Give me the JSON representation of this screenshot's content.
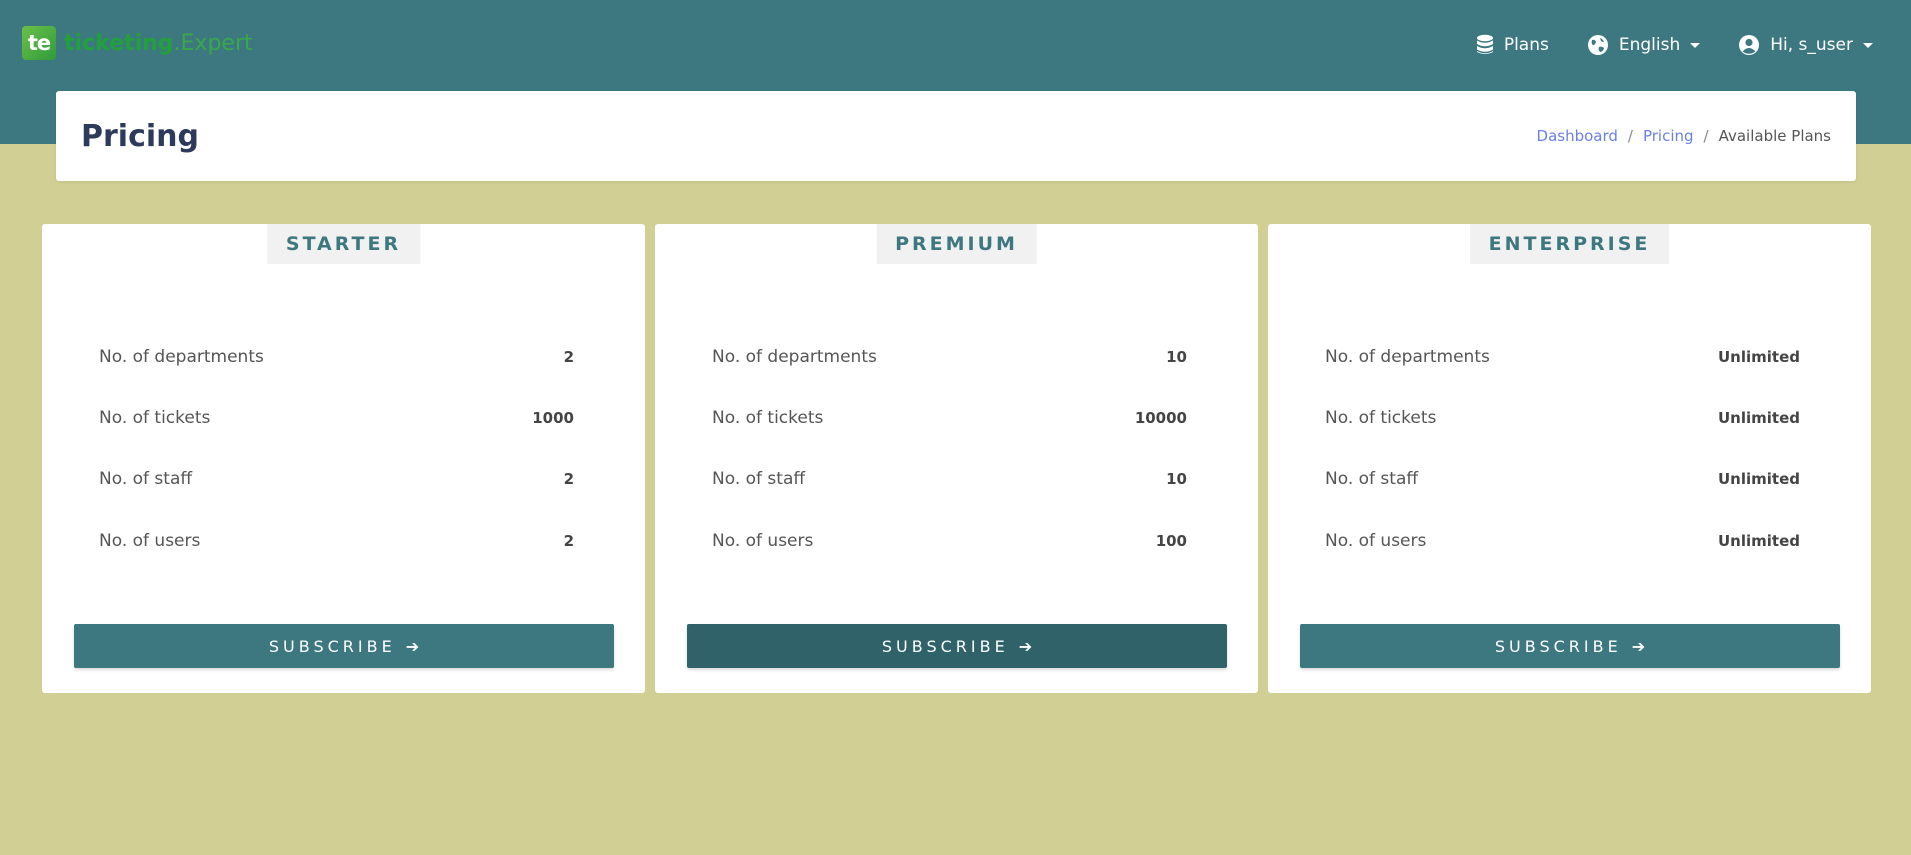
{
  "brand": {
    "badge": "te",
    "name_bold": "ticketing",
    "name_light": ".Expert"
  },
  "nav": {
    "plans_label": "Plans",
    "language_label": "English",
    "user_label": "Hi, s_user"
  },
  "header": {
    "title": "Pricing",
    "breadcrumb": [
      "Dashboard",
      "Pricing",
      "Available Plans"
    ],
    "separator": "/"
  },
  "plans": [
    {
      "name": "STARTER",
      "features": [
        {
          "label": "No. of departments",
          "value": "2"
        },
        {
          "label": "No. of tickets",
          "value": "1000"
        },
        {
          "label": "No. of staff",
          "value": "2"
        },
        {
          "label": "No. of users",
          "value": "2"
        }
      ],
      "button_label": "SUBSCRIBE"
    },
    {
      "name": "PREMIUM",
      "features": [
        {
          "label": "No. of departments",
          "value": "10"
        },
        {
          "label": "No. of tickets",
          "value": "10000"
        },
        {
          "label": "No. of staff",
          "value": "10"
        },
        {
          "label": "No. of users",
          "value": "100"
        }
      ],
      "button_label": "SUBSCRIBE"
    },
    {
      "name": "ENTERPRISE",
      "features": [
        {
          "label": "No. of departments",
          "value": "Unlimited"
        },
        {
          "label": "No. of tickets",
          "value": "Unlimited"
        },
        {
          "label": "No. of staff",
          "value": "Unlimited"
        },
        {
          "label": "No. of users",
          "value": "Unlimited"
        }
      ],
      "button_label": "SUBSCRIBE"
    }
  ],
  "colors": {
    "topbar": "#3d7880",
    "page_background": "#d1cf93",
    "accent": "#3d7880",
    "link": "#6b80e8"
  }
}
